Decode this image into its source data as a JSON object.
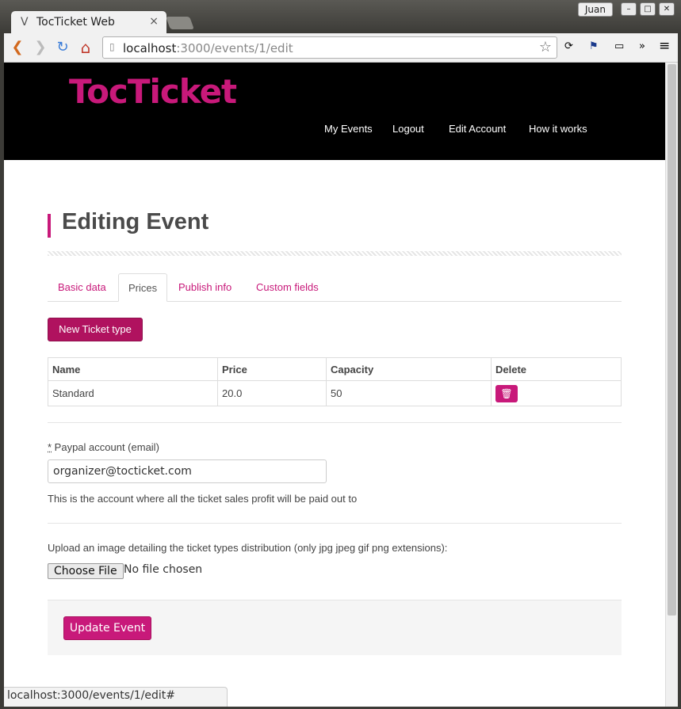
{
  "window": {
    "tab_title": "TocTicket Web",
    "tab_close": "×",
    "tab_favicon": "V",
    "user": "Juan",
    "minimize": "–",
    "maximize": "□",
    "close": "✕"
  },
  "toolbar": {
    "url_host": "localhost",
    "url_path": ":3000/events/1/edit",
    "back_glyph": "❮",
    "forward_glyph": "❯",
    "reload_glyph": "↻",
    "home_glyph": "⌂",
    "star_glyph": "☆",
    "menu_glyph": "≡",
    "more_glyph": "»"
  },
  "site": {
    "brand": "TocTicket",
    "brand_color": "#c8197a",
    "nav": [
      "My Events",
      "Logout",
      "Edit Account",
      "How it works"
    ]
  },
  "page": {
    "title": "Editing Event",
    "tabs": [
      {
        "label": "Basic data",
        "active": false
      },
      {
        "label": "Prices",
        "active": true
      },
      {
        "label": "Publish info",
        "active": false
      },
      {
        "label": "Custom fields",
        "active": false
      }
    ],
    "new_ticket_button": "New Ticket type",
    "table": {
      "headers": [
        "Name",
        "Price",
        "Capacity",
        "Delete"
      ],
      "rows": [
        {
          "name": "Standard",
          "price": "20.0",
          "capacity": "50",
          "delete_icon": "trash-icon"
        }
      ]
    },
    "paypal": {
      "required_marker": "*",
      "label": " Paypal account (email)",
      "value": "organizer@tocticket.com",
      "help": "This is the account where all the ticket sales profit will be paid out to"
    },
    "upload": {
      "label": "Upload an image detailing the ticket types distribution (only jpg jpeg gif png extensions):",
      "button": "Choose File",
      "status": "No file chosen"
    },
    "submit": "Update Event"
  },
  "status_bar": "localhost:3000/events/1/edit#"
}
